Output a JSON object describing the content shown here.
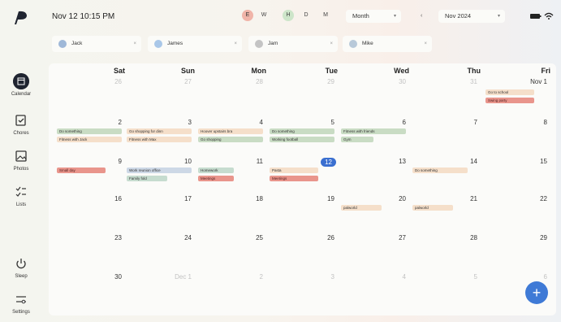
{
  "header": {
    "datetime": "Nov 12 10:15 PM",
    "view_toggles": [
      "E",
      "W",
      "H",
      "D",
      "M"
    ],
    "view_dropdown": "Month",
    "month_dropdown": "Nov 2024",
    "prev_label": "‹"
  },
  "sidebar": {
    "items": [
      {
        "label": "Calendar"
      },
      {
        "label": "Chores"
      },
      {
        "label": "Photos"
      },
      {
        "label": "Lists"
      },
      {
        "label": "Sleep"
      },
      {
        "label": "Settings"
      }
    ]
  },
  "filters": {
    "people": [
      {
        "name": "Jack",
        "color": "#9fb8d8"
      },
      {
        "name": "James",
        "color": "#a9c7e8"
      },
      {
        "name": "Jam",
        "color": "#c4c4c4"
      },
      {
        "name": "Mike",
        "color": "#b8c9d9"
      }
    ]
  },
  "calendar": {
    "weekdays": [
      "Sat",
      "Sun",
      "Mon",
      "Tue",
      "Wed",
      "Thu",
      "Fri"
    ],
    "weekday_dates": [
      "26",
      "27",
      "28",
      "29",
      "30",
      "31",
      "Nov 1"
    ],
    "weeks": [
      [
        "2",
        "3",
        "4",
        "5",
        "6",
        "7",
        "8"
      ],
      [
        "9",
        "10",
        "11",
        "12",
        "13",
        "14",
        "15"
      ],
      [
        "16",
        "17",
        "18",
        "19",
        "20",
        "21",
        "22"
      ],
      [
        "23",
        "24",
        "25",
        "26",
        "27",
        "28",
        "29"
      ],
      [
        "30",
        "Dec 1",
        "2",
        "3",
        "4",
        "5",
        "6"
      ]
    ],
    "events": {
      "fri1_a": "Go to school",
      "fri1_b": "Swing party",
      "sat2_a": "Do something",
      "sat2_b": "Fitness with Jack",
      "sun3_a": "Go shopping for dinn",
      "sun3_b": "Fitness with Max",
      "mon4_a": "Hoover upstairs bra",
      "mon4_b": "Go shopping",
      "tue5_a": "Do something",
      "tue5_b": "Working football",
      "wed6_a": "Fitness with friends",
      "wed6_b": "Gym",
      "sat9_a": "Small day",
      "sun10_a": "Work reunion office",
      "sun10_b": "Family fold",
      "mon11_a": "Homework",
      "mon11_b": "Meetings",
      "tue12_a": "Pasta",
      "tue12_b": "Meetings",
      "thu14_a": "Do something",
      "wed20_a": "palworld",
      "thu21_a": "palworld"
    }
  },
  "fab": {
    "label": "+"
  }
}
